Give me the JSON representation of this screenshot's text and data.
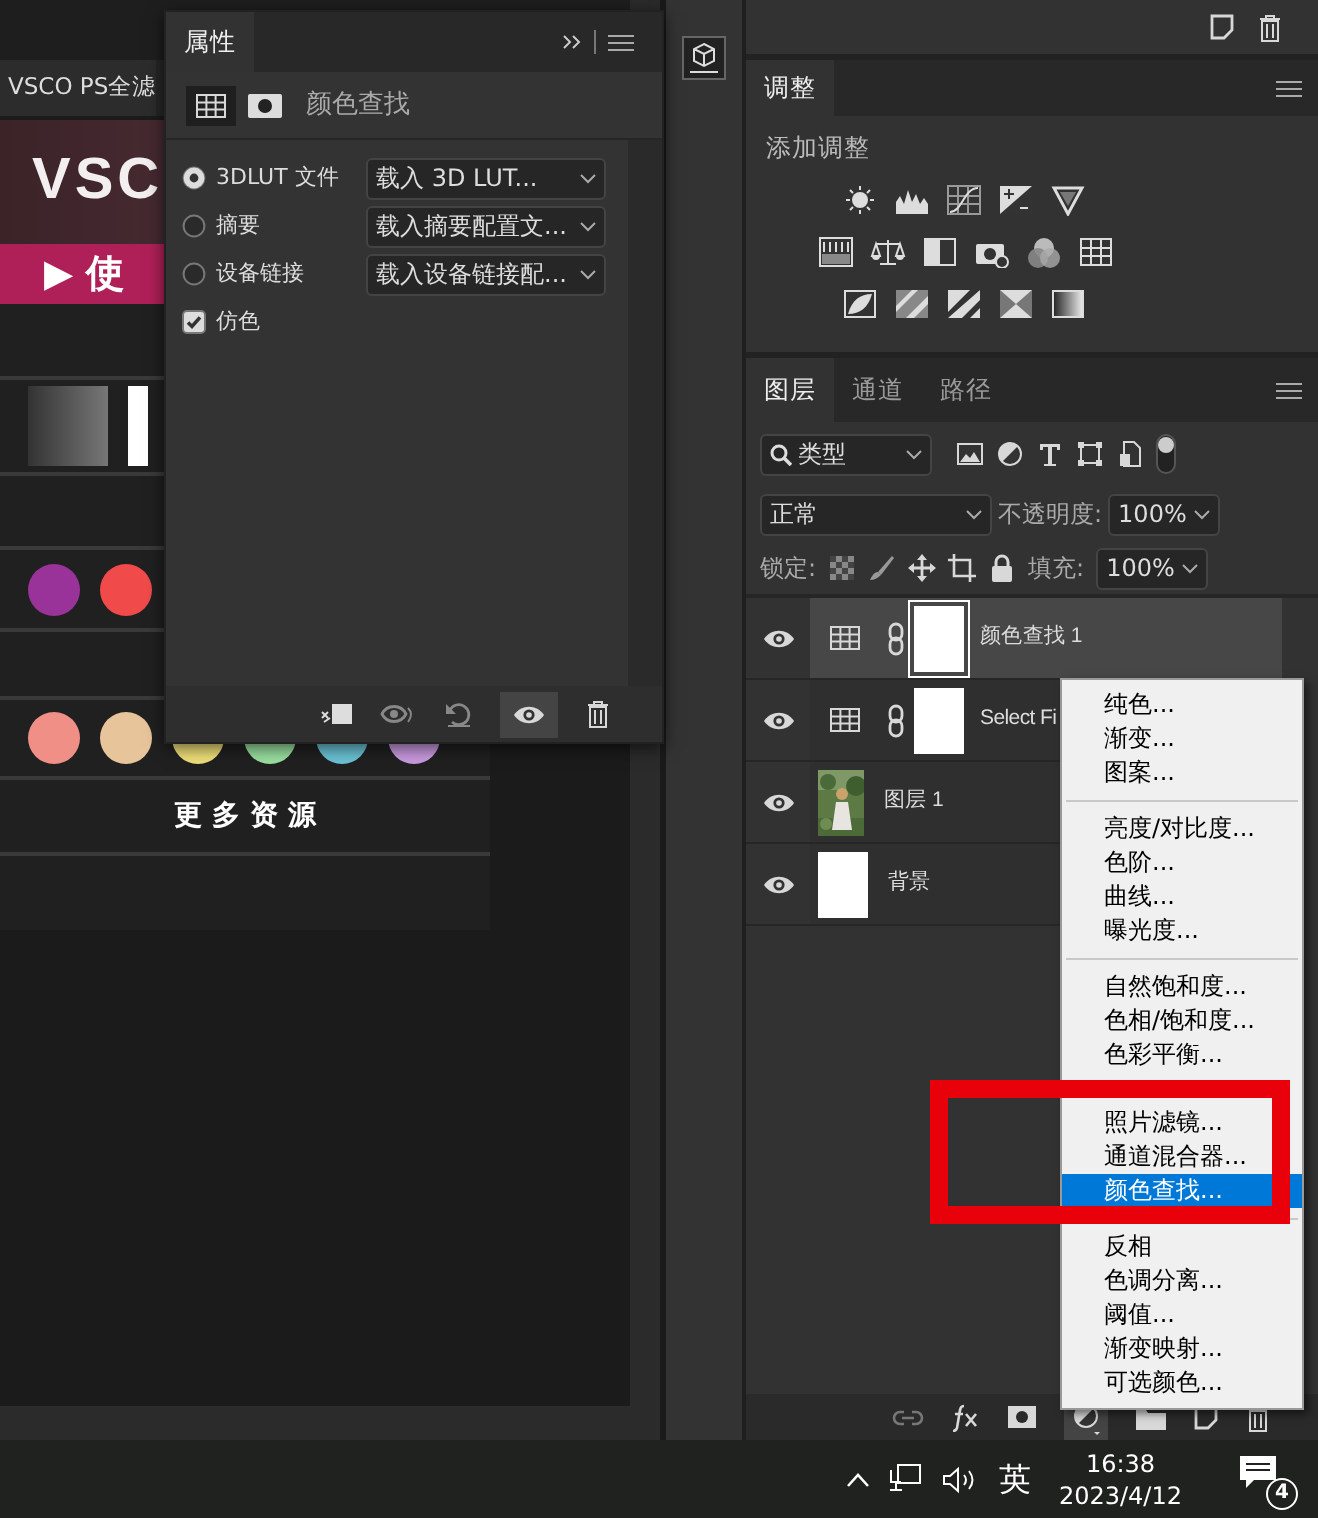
{
  "document": {
    "tab_title": "VSCO PS全滤",
    "image": {
      "title": "VSC",
      "button": "▶ 使",
      "swatch_rows": [
        [
          {
            "color": "#993399"
          },
          {
            "color": "#f04a4a"
          }
        ],
        [
          {
            "color": "#ef8f86"
          },
          {
            "color": "#e8c49a"
          },
          {
            "color": "#f0e07a"
          },
          {
            "color": "#9ae0a0"
          },
          {
            "color": "#6cc3d6"
          },
          {
            "color": "#c99ae0"
          }
        ]
      ],
      "footer": "更 多 资 源"
    }
  },
  "properties_panel": {
    "tab": "属性",
    "adjustment_name": "颜色查找",
    "options": [
      {
        "kind": "radio",
        "label": "3DLUT 文件",
        "selected": true,
        "dropdown": "载入 3D LUT..."
      },
      {
        "kind": "radio",
        "label": "摘要",
        "selected": false,
        "dropdown": "载入摘要配置文..."
      },
      {
        "kind": "radio",
        "label": "设备链接",
        "selected": false,
        "dropdown": "载入设备链接配..."
      },
      {
        "kind": "checkbox",
        "label": "仿色",
        "checked": true
      }
    ]
  },
  "adjustments_panel": {
    "tab": "调整",
    "heading": "添加调整"
  },
  "layers_panel": {
    "tabs": [
      {
        "label": "图层",
        "selected": true
      },
      {
        "label": "通道",
        "selected": false
      },
      {
        "label": "路径",
        "selected": false
      }
    ],
    "filter": "类型",
    "blend_mode": "正常",
    "opacity_label": "不透明度:",
    "opacity": "100%",
    "lock_label": "锁定:",
    "fill_label": "填充:",
    "fill": "100%",
    "layers": [
      {
        "name": "颜色查找 1",
        "kind": "adjustment",
        "selected": true,
        "visible": true
      },
      {
        "name": "Select Fi",
        "kind": "adjustment",
        "selected": false,
        "visible": true
      },
      {
        "name": "图层 1",
        "selected": false,
        "visible": true
      },
      {
        "name": "背景",
        "kind": "plain",
        "selected": false,
        "visible": true
      }
    ]
  },
  "context_menu": {
    "groups": [
      [
        {
          "kind": "item",
          "label": "纯色...",
          "selected": false
        },
        {
          "kind": "item",
          "label": "渐变...",
          "selected": false
        },
        {
          "kind": "item",
          "label": "图案...",
          "selected": false
        }
      ],
      [
        {
          "kind": "item",
          "label": "亮度/对比度...",
          "selected": false
        },
        {
          "kind": "item",
          "label": "色阶...",
          "selected": false
        },
        {
          "kind": "item",
          "label": "曲线...",
          "selected": false
        },
        {
          "kind": "item",
          "label": "曝光度...",
          "selected": false
        }
      ],
      [
        {
          "kind": "item",
          "label": "自然饱和度...",
          "selected": false
        },
        {
          "kind": "item",
          "label": "色相/饱和度...",
          "selected": false
        },
        {
          "kind": "item",
          "label": "色彩平衡...",
          "selected": false
        },
        {
          "kind": "covered"
        },
        {
          "kind": "item",
          "label": "照片滤镜...",
          "selected": false
        },
        {
          "kind": "item",
          "label": "通道混合器...",
          "selected": false
        },
        {
          "kind": "item",
          "label": "颜色查找...",
          "selected": true
        }
      ],
      [
        {
          "kind": "item",
          "label": "反相",
          "selected": false
        },
        {
          "kind": "item",
          "label": "色调分离...",
          "selected": false
        },
        {
          "kind": "item",
          "label": "阈值...",
          "selected": false
        },
        {
          "kind": "item",
          "label": "渐变映射...",
          "selected": false
        },
        {
          "kind": "item",
          "label": "可选颜色...",
          "selected": false
        }
      ]
    ]
  },
  "taskbar": {
    "ime": "英",
    "time": "16:38",
    "date": "2023/4/12",
    "notifications": "4"
  }
}
